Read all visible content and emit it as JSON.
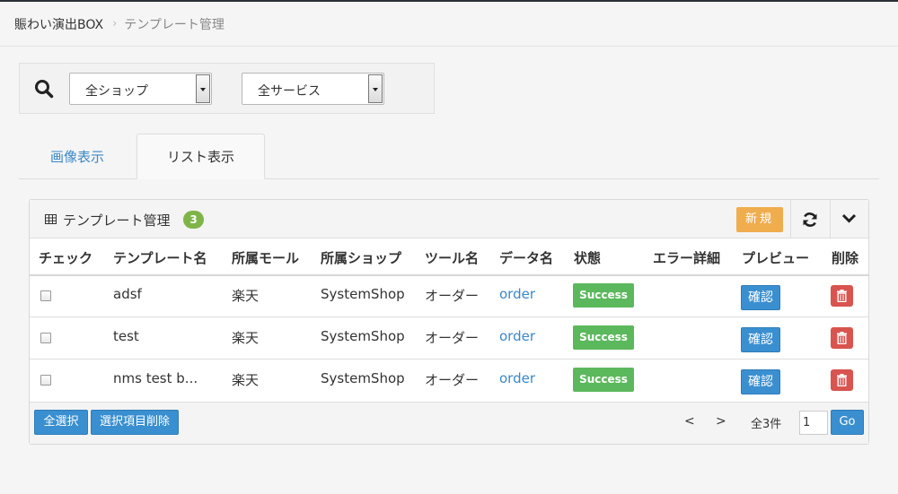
{
  "breadcrumb": {
    "home": "賑わい演出BOX",
    "current": "テンプレート管理"
  },
  "filters": {
    "shop": "全ショップ",
    "service": "全サービス"
  },
  "tabs": [
    {
      "label": "画像表示",
      "active": false
    },
    {
      "label": "リスト表示",
      "active": true
    }
  ],
  "panel": {
    "title": "テンプレート管理",
    "count": "3",
    "new_label": "新規",
    "columns": [
      "チェック",
      "テンプレート名",
      "所属モール",
      "所属ショップ",
      "ツール名",
      "データ名",
      "状態",
      "エラー詳細",
      "プレビュー",
      "削除"
    ],
    "rows": [
      {
        "name": "adsf",
        "mall": "楽天",
        "shop": "SystemShop",
        "tool": "オーダー",
        "data": "order",
        "status": "Success",
        "error": "",
        "preview": "確認"
      },
      {
        "name": "test",
        "mall": "楽天",
        "shop": "SystemShop",
        "tool": "オーダー",
        "data": "order",
        "status": "Success",
        "error": "",
        "preview": "確認"
      },
      {
        "name": "nms test b...",
        "mall": "楽天",
        "shop": "SystemShop",
        "tool": "オーダー",
        "data": "order",
        "status": "Success",
        "error": "",
        "preview": "確認"
      }
    ]
  },
  "footer": {
    "select_all": "全選択",
    "delete_selected": "選択項目削除",
    "prev": "<",
    "next": ">",
    "total": "全3件",
    "page": "1",
    "go": "Go"
  },
  "colors": {
    "accent": "#3a87c8",
    "success": "#5cb85c",
    "warning": "#f0ad4e",
    "danger": "#d9534f",
    "badge": "#7fb548"
  }
}
